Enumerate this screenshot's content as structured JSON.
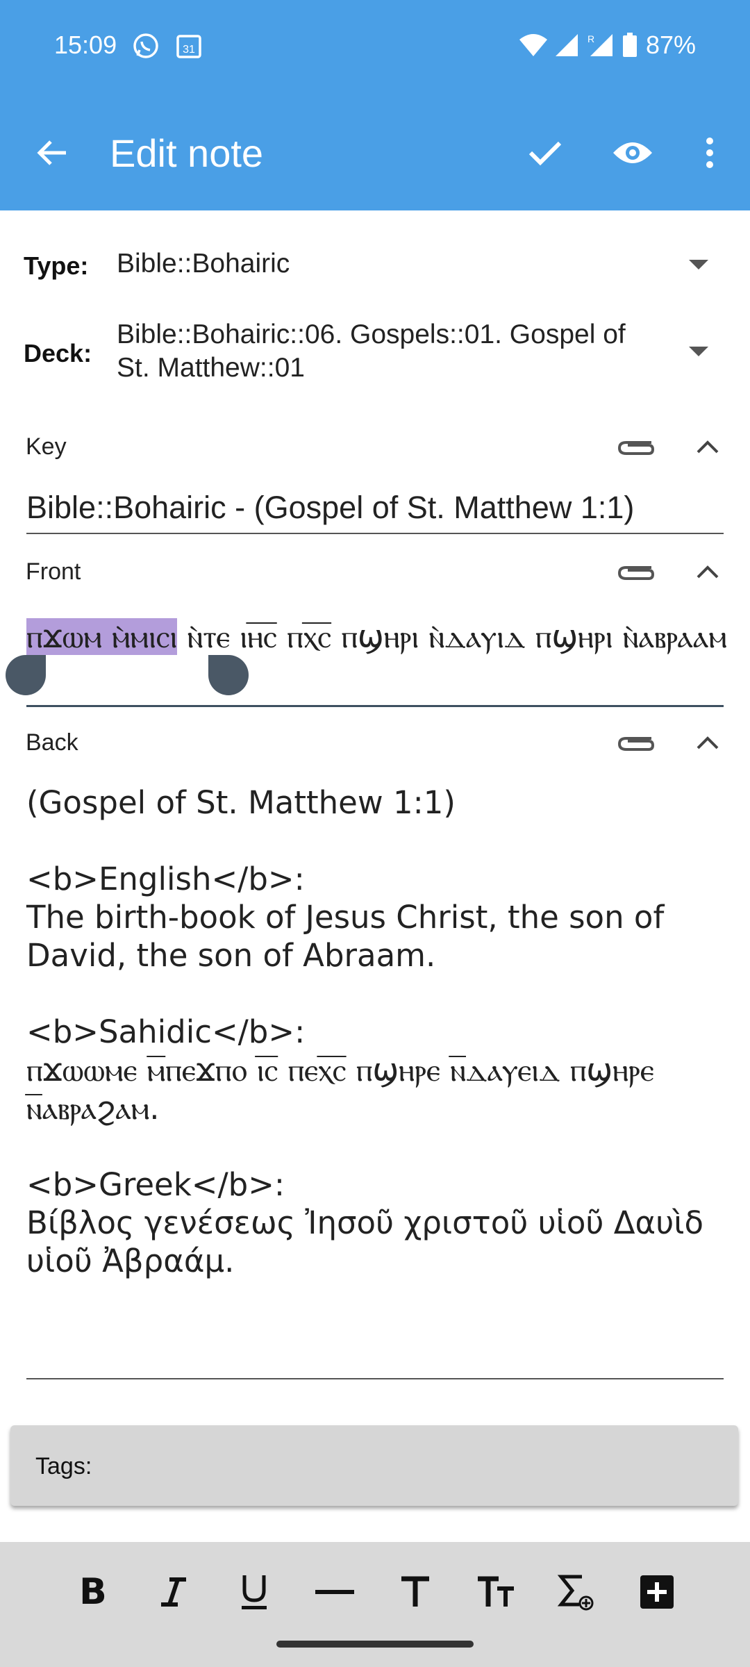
{
  "status_bar": {
    "time": "15:09",
    "battery": "87%",
    "left_icons": [
      "whatsapp-icon",
      "calendar-icon"
    ],
    "right_icons": [
      "wifi-icon",
      "signal-icon",
      "signal-roaming-icon",
      "battery-icon"
    ]
  },
  "app_bar": {
    "title": "Edit note",
    "color": "#4a9fe6",
    "actions": [
      "back-arrow-icon",
      "check-icon",
      "eye-icon",
      "more-vert-icon"
    ]
  },
  "note_meta": {
    "type_label": "Type:",
    "type_value": "Bible::Bohairic",
    "deck_label": "Deck:",
    "deck_value": "Bible::Bohairic::06. Gospels::01. Gospel of St. Matthew::01"
  },
  "fields": {
    "key_label": "Key",
    "key_value": "Bible::Bohairic - (Gospel of St. Matthew 1:1)",
    "front_label": "Front",
    "front_selected": "ⲡϫⲱⲙ ⲙ̀ⲙⲓⲥⲓ",
    "front_rest": " ⲛ̀ⲧⲉ ⲓⲏ̅ⲥ̅ ⲡⲭ̅ⲥ̅ ⲡϣⲏⲣⲓ ⲛ̀ⲇⲁⲩⲓⲇ ⲡϣⲏⲣⲓ ⲛ̀ⲁⲃⲣⲁⲁⲙ",
    "back_label": "Back",
    "back_value": "(Gospel of St. Matthew 1:1)\n\n<b>English</b>:\nThe birth-book of Jesus Christ, the son of David, the son of Abraam.\n\n<b>Sahidic</b>:\nⲡϫⲱⲱⲙⲉ ⲙ̅ⲡⲉϫⲡⲟ ⲓ̅ⲥ̅ ⲡⲉⲭ̅ⲥ̅ ⲡϣⲏⲣⲉ ⲛ̅ⲇⲁⲩⲉⲓⲇ ⲡϣⲏⲣⲉ ⲛ̅ⲁⲃⲣⲁϩⲁⲙ.\n\n<b>Greek</b>:\nΒίβλος γενέσεως Ἰησοῦ χριστοῦ υἱοῦ Δαυὶδ υἱοῦ Ἀβραάμ."
  },
  "tags": {
    "label": "Tags:"
  },
  "format_toolbar": {
    "buttons": [
      "bold-icon",
      "italic-icon",
      "underline-icon",
      "horizontal-rule-icon",
      "text-size-icon",
      "font-size-icon",
      "math-sum-icon",
      "add-box-icon"
    ]
  }
}
